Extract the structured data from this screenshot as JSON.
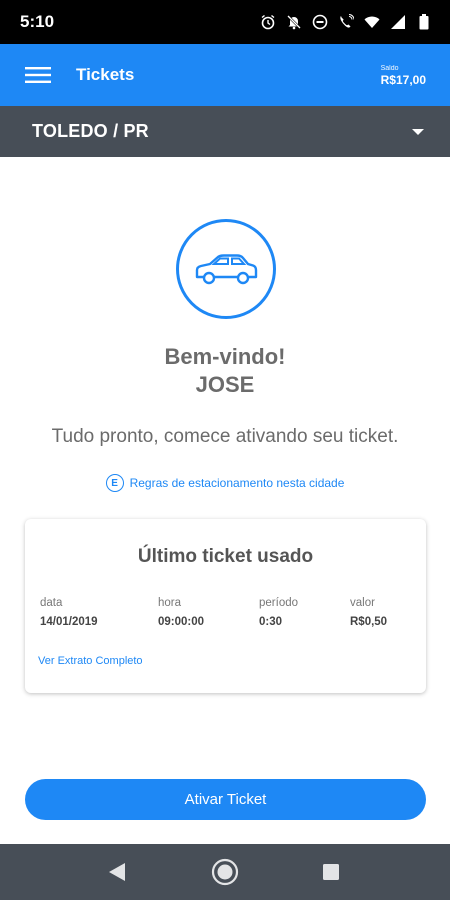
{
  "status_bar": {
    "time": "5:10",
    "icons": [
      "alarm-icon",
      "notifications-off-icon",
      "do-not-disturb-icon",
      "wifi-calling-icon",
      "wifi-icon",
      "signal-icon",
      "battery-icon"
    ]
  },
  "app_bar": {
    "title": "Tickets",
    "balance_label": "Saldo",
    "balance_value": "R$17,00"
  },
  "city": {
    "name": "TOLEDO / PR"
  },
  "welcome": {
    "greeting": "Bem-vindo!",
    "user": "JOSE",
    "ready_text": "Tudo pronto, comece ativando seu ticket.",
    "rules_icon_letter": "E",
    "rules_link": "Regras de estacionamento nesta cidade"
  },
  "last_ticket": {
    "title": "Último ticket usado",
    "columns": [
      {
        "label": "data",
        "value": "14/01/2019"
      },
      {
        "label": "hora",
        "value": "09:00:00"
      },
      {
        "label": "período",
        "value": "0:30"
      },
      {
        "label": "valor",
        "value": "R$0,50"
      }
    ],
    "extract_link": "Ver Extrato Completo"
  },
  "actions": {
    "activate_label": "Ativar Ticket"
  },
  "colors": {
    "primary": "#1e88f5",
    "city_bar": "#474e57",
    "nav_bar": "#474e57",
    "text_gray": "#6b6b6b"
  }
}
